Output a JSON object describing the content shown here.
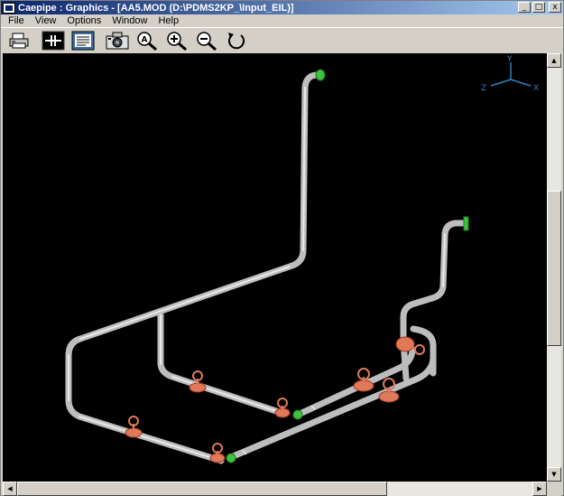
{
  "window": {
    "title": "Caepipe : Graphics - [AA5.MOD (D:\\PDMS2KP_\\Input_EIL)]",
    "buttons": {
      "minimize": "_",
      "restore": "□",
      "close": "x"
    }
  },
  "menu": [
    "File",
    "View",
    "Options",
    "Window",
    "Help"
  ],
  "toolbar": [
    {
      "name": "print-button",
      "icon": "printer-icon"
    },
    {
      "name": "pipe-view-button",
      "icon": "pipe-icon"
    },
    {
      "name": "list-view-button",
      "icon": "document-list-icon"
    },
    {
      "name": "snapshot-button",
      "icon": "camera-icon"
    },
    {
      "name": "zoom-all-button",
      "icon": "zoom-all-icon"
    },
    {
      "name": "zoom-in-button",
      "icon": "zoom-in-icon"
    },
    {
      "name": "zoom-out-button",
      "icon": "zoom-out-icon"
    },
    {
      "name": "rotate-button",
      "icon": "rotate-icon"
    }
  ],
  "axes": {
    "y": "Y",
    "z": "Z",
    "x": "X"
  },
  "colors": {
    "pipe": "#bdbdbd",
    "valve": "#e0785a",
    "flange": "#40c040",
    "canvas": "#000000",
    "axis": "#2f80c0"
  },
  "scroll": {
    "up": "▲",
    "down": "▼",
    "left": "◀",
    "right": "▶"
  }
}
